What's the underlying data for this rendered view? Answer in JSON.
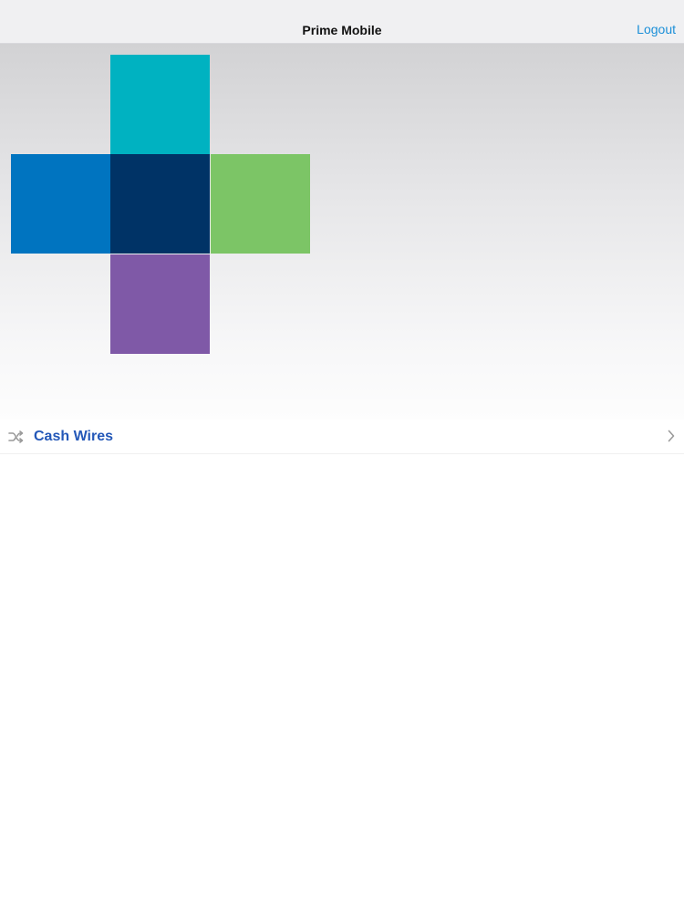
{
  "navbar": {
    "title": "Prime Mobile",
    "logout_label": "Logout"
  },
  "logo": {
    "icon": "cross-tiles-logo",
    "colors": {
      "top": "#00b2c1",
      "left": "#0074c0",
      "center": "#003366",
      "right": "#7cc566",
      "bottom": "#7f59a7"
    }
  },
  "menu": {
    "items": [
      {
        "label": "Cash Wires",
        "icon": "shuffle-icon",
        "trailing_icon": "chevron-right-icon"
      }
    ]
  },
  "colors": {
    "link": "#1a8fd8",
    "menu_label": "#2458b8",
    "icon_gray": "#9a9a9a"
  }
}
